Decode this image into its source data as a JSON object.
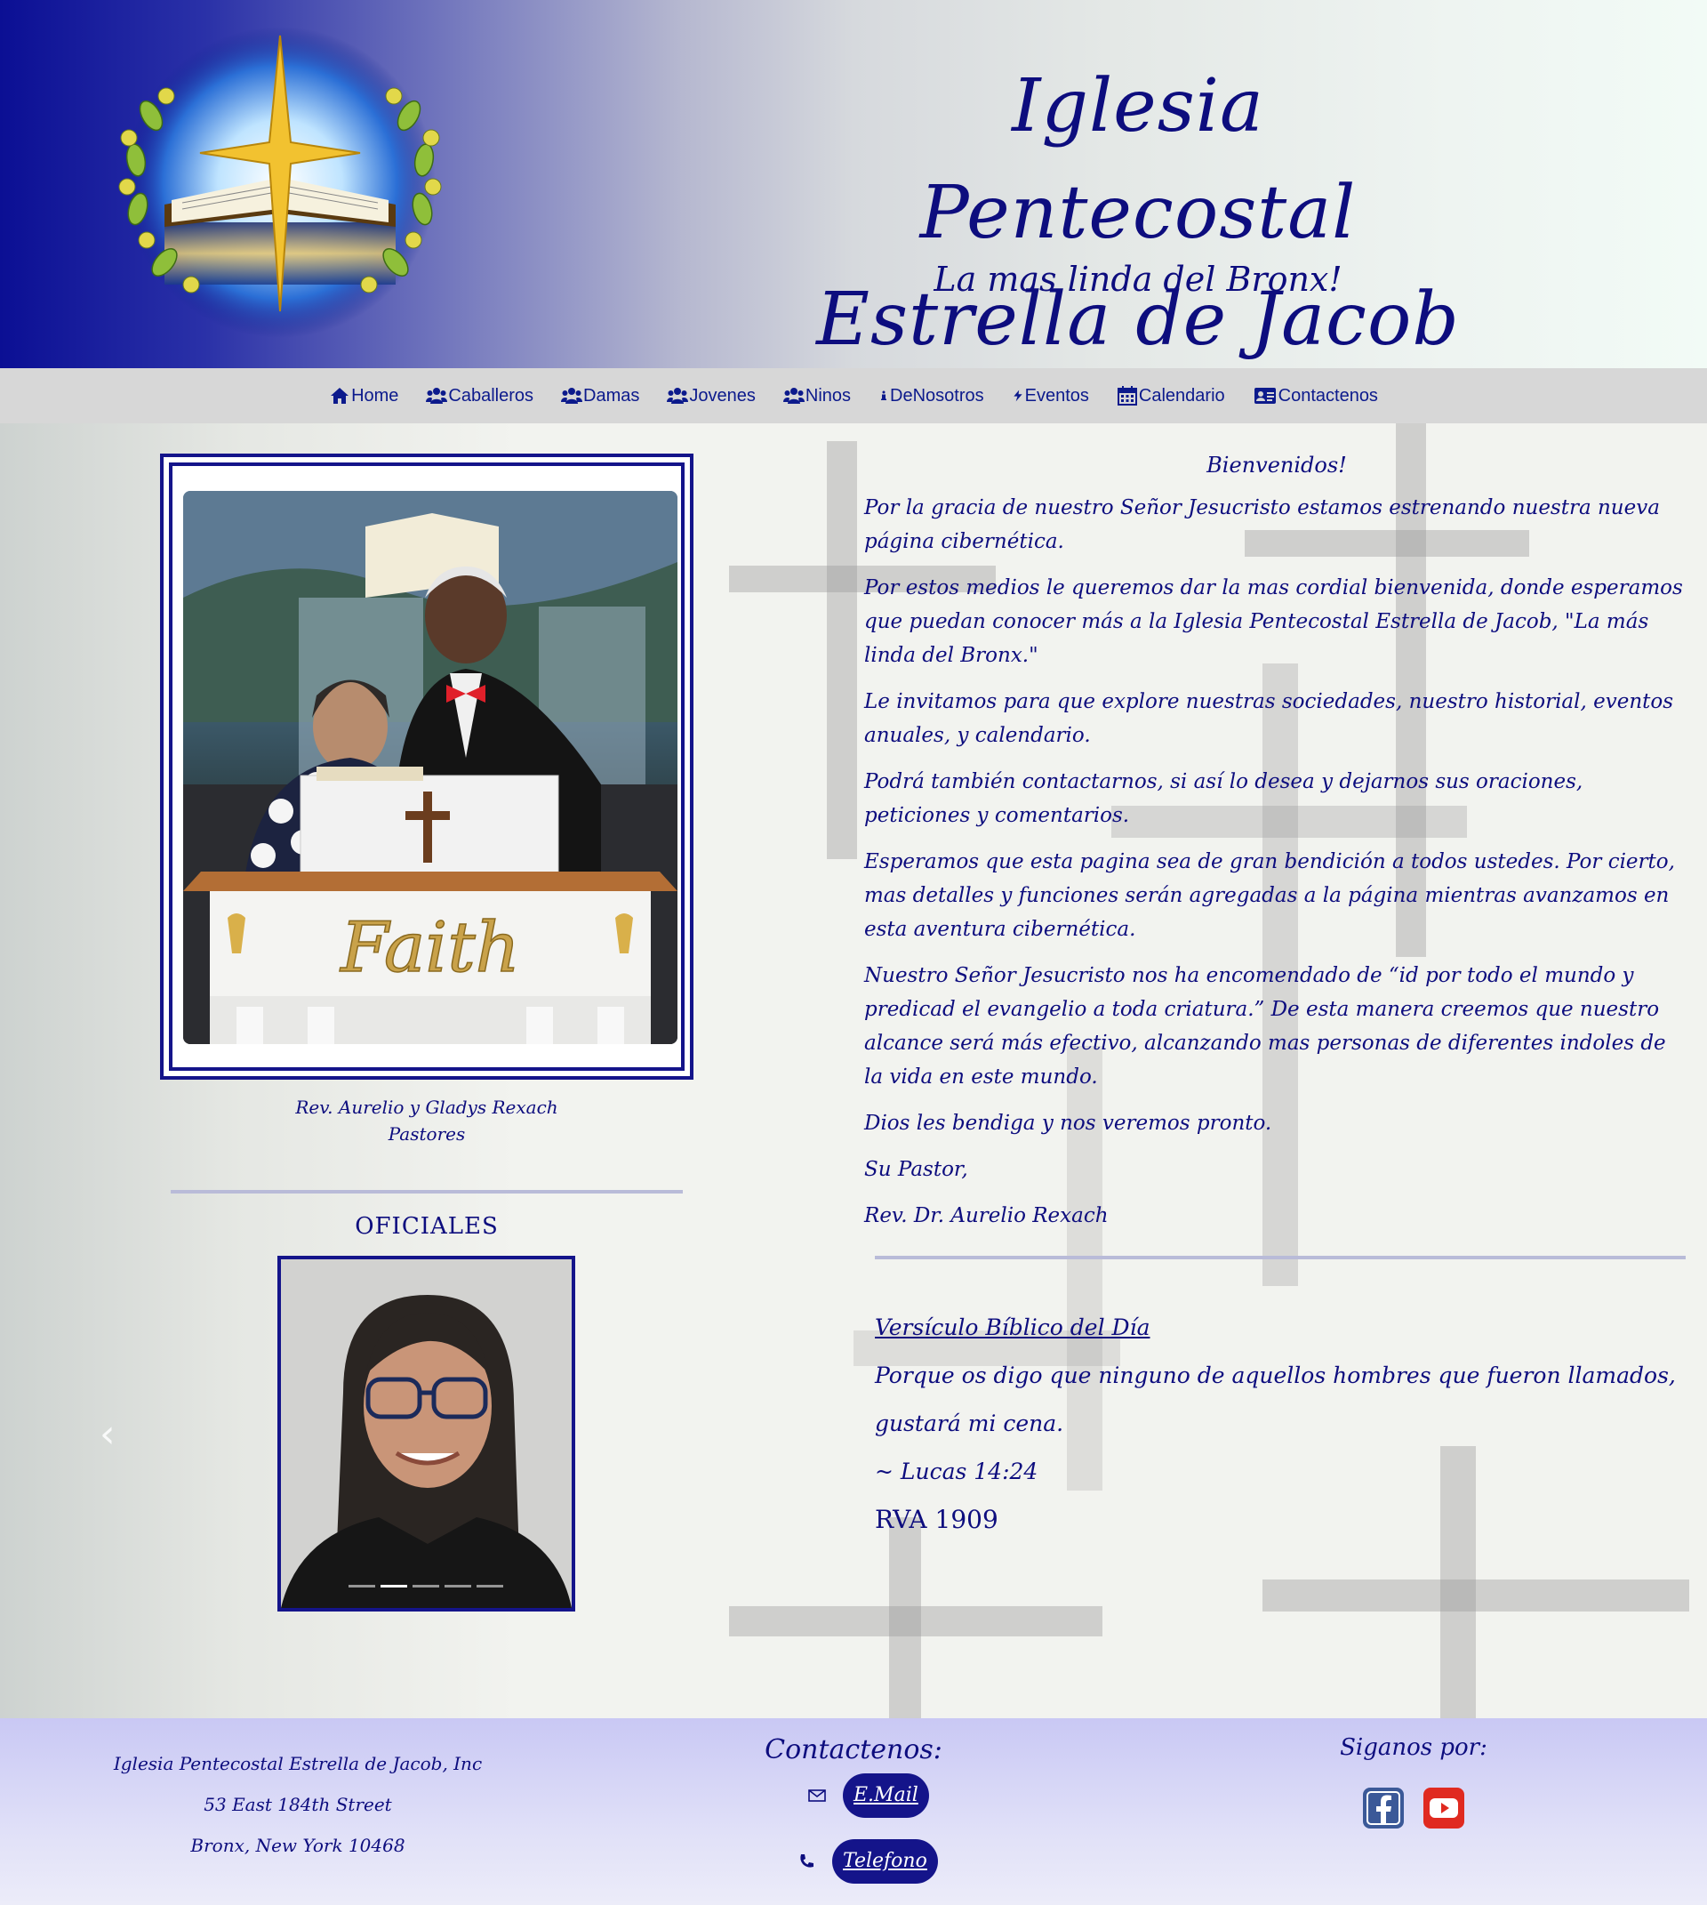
{
  "header": {
    "title_line1": "Iglesia Pentecostal",
    "title_line2": "Estrella de Jacob",
    "tagline": "La mas linda del Bronx!"
  },
  "nav": {
    "items": [
      {
        "label": "Home",
        "icon": "home-icon"
      },
      {
        "label": "Caballeros",
        "icon": "users-icon"
      },
      {
        "label": "Damas",
        "icon": "users-icon"
      },
      {
        "label": "Jovenes",
        "icon": "users-icon"
      },
      {
        "label": "Ninos",
        "icon": "users-icon"
      },
      {
        "label": "DeNosotros",
        "icon": "info-icon"
      },
      {
        "label": "Eventos",
        "icon": "bolt-icon"
      },
      {
        "label": "Calendario",
        "icon": "calendar-icon"
      },
      {
        "label": "Contactenos",
        "icon": "address-card-icon"
      }
    ]
  },
  "pastors": {
    "caption_line1": "Rev. Aurelio y Gladys Rexach",
    "caption_line2": "Pastores",
    "pulpit_text": "Faith"
  },
  "officials": {
    "title": "OFICIALES",
    "slide_count": 5,
    "active_slide": 2
  },
  "welcome": {
    "title": "Bienvenidos!",
    "paragraphs": [
      "Por la gracia de nuestro Señor Jesucristo estamos estrenando nuestra nueva página cibernética.",
      "Por estos medios le queremos dar la mas cordial bienvenida, donde esperamos que puedan conocer más a la Iglesia Pentecostal Estrella de Jacob, \"La más linda del Bronx.\"",
      "Le invitamos para que explore nuestras sociedades, nuestro historial, eventos anuales, y calendario.",
      "Podrá también contactarnos, si así lo desea y dejarnos sus oraciones, peticiones y comentarios.",
      "Esperamos que esta pagina sea de gran bendición a todos ustedes. Por cierto, mas detalles y funciones serán agregadas a la página mientras avanzamos en esta aventura cibernética.",
      "Nuestro Señor Jesucristo nos ha encomendado de “id por todo el mundo y predicad el evangelio a toda criatura.” De esta manera creemos que nuestro alcance será más efectivo, alcanzando mas personas de diferentes indoles de la vida en este mundo.",
      "Dios les bendiga y nos veremos pronto.",
      "Su Pastor,",
      "Rev. Dr. Aurelio Rexach"
    ]
  },
  "verse": {
    "title": "Versículo Bíblico del Día",
    "text": "Porque os digo que ninguno de aquellos hombres que fueron llamados, gustará mi cena.",
    "reference": "~ Lucas 14:24",
    "version": "RVA 1909"
  },
  "footer": {
    "address_line1": "Iglesia Pentecostal Estrella de Jacob, Inc",
    "address_line2": "53 East 184th Street",
    "address_line3": "Bronx, New York 10468",
    "contact_title": "Contactenos:",
    "email_label": "E.Mail",
    "phone_label": "Telefono",
    "social_title": "Siganos por:",
    "facebook_color": "#3b5998",
    "youtube_color": "#e02a20"
  }
}
